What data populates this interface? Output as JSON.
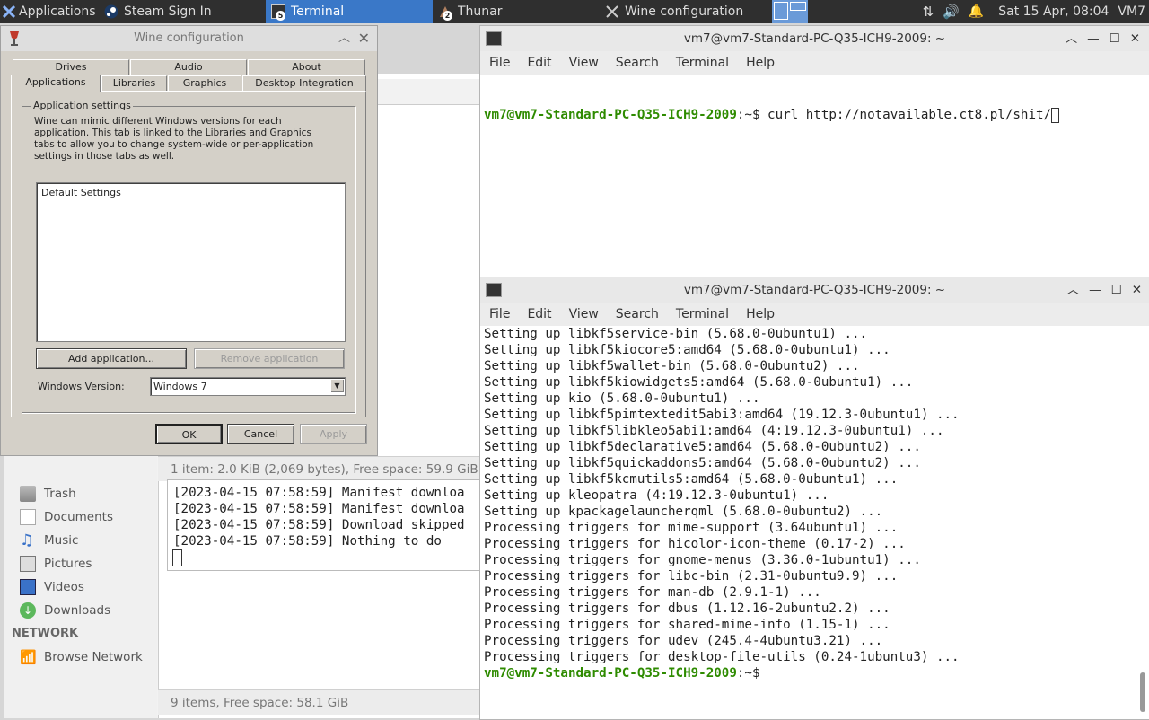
{
  "panel": {
    "apps_label": "Applications ☰",
    "tasks": [
      {
        "label": "Steam Sign In"
      },
      {
        "label": "Terminal",
        "count": "5"
      },
      {
        "label": "Thunar",
        "count": "2"
      },
      {
        "label": "Wine configuration"
      }
    ],
    "clock": "Sat 15 Apr, 08:04",
    "user": "VM7"
  },
  "wine": {
    "title": "Wine configuration",
    "tabs_top": [
      "Drives",
      "Audio",
      "About"
    ],
    "tabs_bottom": [
      "Applications",
      "Libraries",
      "Graphics",
      "Desktop Integration"
    ],
    "group_label": "Application settings",
    "description": "Wine can mimic different Windows versions for each application. This tab is linked to the Libraries and Graphics tabs to allow you to change system-wide or per-application settings in those tabs as well.",
    "list_items": [
      "Default Settings"
    ],
    "add_button": "Add application...",
    "remove_button": "Remove application",
    "version_label": "Windows Version:",
    "version_value": "Windows 7",
    "ok": "OK",
    "cancel": "Cancel",
    "apply": "Apply"
  },
  "filemanager": {
    "status_top": "1 item: 2.0 KiB (2,069 bytes), Free space: 59.9 GiB",
    "status_bottom": "9 items, Free space: 58.1 GiB",
    "places": [
      "Trash",
      "Documents",
      "Music",
      "Pictures",
      "Videos",
      "Downloads"
    ],
    "network_head": "NETWORK",
    "network_items": [
      "Browse Network"
    ]
  },
  "steam_log": [
    "[2023-04-15 07:58:59] Manifest downloa",
    "[2023-04-15 07:58:59] Manifest downloa",
    "[2023-04-15 07:58:59] Download skipped",
    "[2023-04-15 07:58:59] Nothing to do"
  ],
  "terminal_top": {
    "title": "vm7@vm7-Standard-PC-Q35-ICH9-2009: ~",
    "menu": [
      "File",
      "Edit",
      "View",
      "Search",
      "Terminal",
      "Help"
    ],
    "prompt": "vm7@vm7-Standard-PC-Q35-ICH9-2009",
    "command": ":~$ curl http://notavailable.ct8.pl/shit/"
  },
  "terminal_bottom": {
    "title": "vm7@vm7-Standard-PC-Q35-ICH9-2009: ~",
    "menu": [
      "File",
      "Edit",
      "View",
      "Search",
      "Terminal",
      "Help"
    ],
    "lines": [
      "Setting up libkf5service-bin (5.68.0-0ubuntu1) ...",
      "Setting up libkf5kiocore5:amd64 (5.68.0-0ubuntu1) ...",
      "Setting up libkf5wallet-bin (5.68.0-0ubuntu2) ...",
      "Setting up libkf5kiowidgets5:amd64 (5.68.0-0ubuntu1) ...",
      "Setting up kio (5.68.0-0ubuntu1) ...",
      "Setting up libkf5pimtextedit5abi3:amd64 (19.12.3-0ubuntu1) ...",
      "Setting up libkf5libkleo5abi1:amd64 (4:19.12.3-0ubuntu1) ...",
      "Setting up libkf5declarative5:amd64 (5.68.0-0ubuntu2) ...",
      "Setting up libkf5quickaddons5:amd64 (5.68.0-0ubuntu2) ...",
      "Setting up libkf5kcmutils5:amd64 (5.68.0-0ubuntu1) ...",
      "Setting up kleopatra (4:19.12.3-0ubuntu1) ...",
      "Setting up kpackagelauncherqml (5.68.0-0ubuntu2) ...",
      "Processing triggers for mime-support (3.64ubuntu1) ...",
      "Processing triggers for hicolor-icon-theme (0.17-2) ...",
      "Processing triggers for gnome-menus (3.36.0-1ubuntu1) ...",
      "Processing triggers for libc-bin (2.31-0ubuntu9.9) ...",
      "Processing triggers for man-db (2.9.1-1) ...",
      "Processing triggers for dbus (1.12.16-2ubuntu2.2) ...",
      "Processing triggers for shared-mime-info (1.15-1) ...",
      "Processing triggers for udev (245.4-4ubuntu3.21) ...",
      "Processing triggers for desktop-file-utils (0.24-1ubuntu3) ..."
    ],
    "prompt": "vm7@vm7-Standard-PC-Q35-ICH9-2009",
    "prompt_tail": ":~$"
  }
}
